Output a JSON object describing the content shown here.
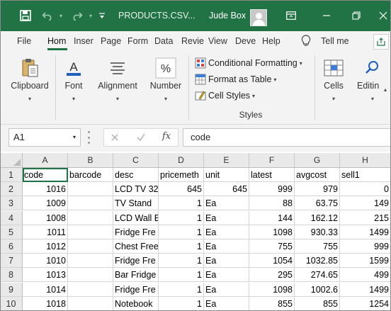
{
  "window": {
    "file_title": "PRODUCTS.CSV...",
    "user_name": "Jude Box"
  },
  "menu": {
    "tabs": [
      "File",
      "Hom",
      "Inser",
      "Page",
      "Form",
      "Data",
      "Revie",
      "View",
      "Deve",
      "Help"
    ],
    "tell_me": "Tell me"
  },
  "ribbon": {
    "clipboard": "Clipboard",
    "font": "Font",
    "alignment": "Alignment",
    "number": "Number",
    "conditional_formatting": "Conditional Formatting",
    "format_as_table": "Format as Table",
    "cell_styles": "Cell Styles",
    "styles_group": "Styles",
    "cells": "Cells",
    "editing": "Editin",
    "font_glyph": "A",
    "number_glyph": "%"
  },
  "formula_bar": {
    "name_box": "A1",
    "fx_label": "fx",
    "content": "code"
  },
  "sheet": {
    "columns": [
      "A",
      "B",
      "C",
      "D",
      "E",
      "F",
      "G",
      "H"
    ],
    "rows": [
      {
        "num": "1",
        "cells": [
          "code",
          "barcode",
          "desc",
          "pricemeth",
          "unit",
          "latest",
          "avgcost",
          "sell1"
        ]
      },
      {
        "num": "2",
        "cells": [
          "1016",
          "",
          "LCD TV 32'",
          "645",
          "645",
          "999",
          "979",
          "0"
        ]
      },
      {
        "num": "3",
        "cells": [
          "1009",
          "",
          "TV Stand",
          "1",
          "Ea",
          "88",
          "63.75",
          "149"
        ]
      },
      {
        "num": "4",
        "cells": [
          "1008",
          "",
          "LCD Wall E",
          "1",
          "Ea",
          "144",
          "162.12",
          "215"
        ]
      },
      {
        "num": "5",
        "cells": [
          "1011",
          "",
          "Fridge Fre",
          "1",
          "Ea",
          "1098",
          "930.33",
          "1499"
        ]
      },
      {
        "num": "6",
        "cells": [
          "1012",
          "",
          "Chest Free",
          "1",
          "Ea",
          "755",
          "755",
          "999"
        ]
      },
      {
        "num": "7",
        "cells": [
          "1010",
          "",
          "Fridge Fre",
          "1",
          "Ea",
          "1054",
          "1032.85",
          "1599"
        ]
      },
      {
        "num": "8",
        "cells": [
          "1013",
          "",
          "Bar Fridge",
          "1",
          "Ea",
          "295",
          "274.65",
          "499"
        ]
      },
      {
        "num": "9",
        "cells": [
          "1014",
          "",
          "Fridge Fre",
          "1",
          "Ea",
          "1098",
          "1002.6",
          "1499"
        ]
      },
      {
        "num": "10",
        "cells": [
          "1018",
          "",
          "Notebook",
          "1",
          "Ea",
          "855",
          "855",
          "1254"
        ]
      }
    ]
  },
  "colors": {
    "accent": "#217346"
  }
}
